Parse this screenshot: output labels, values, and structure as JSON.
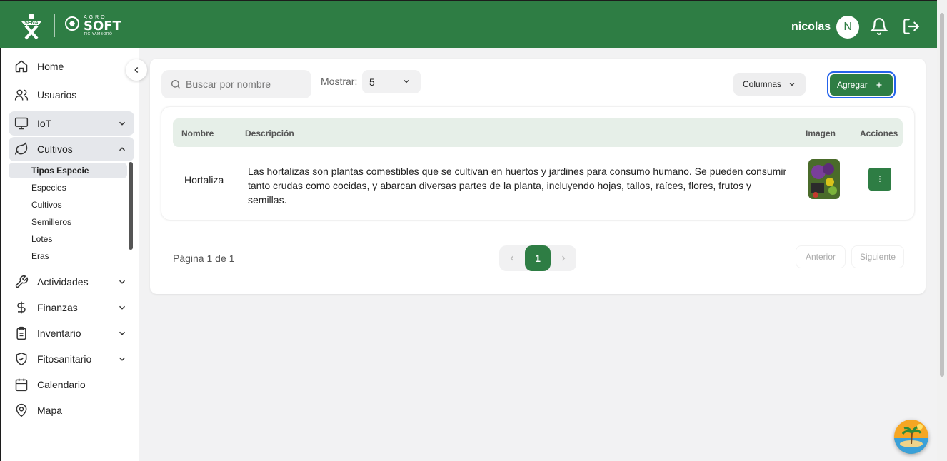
{
  "header": {
    "brand_sena": "SENA",
    "brand_agro": "AGRO",
    "brand_soft": "SOFT",
    "brand_tic": "TIC-YAMBORÓ",
    "user_name": "nicolas",
    "avatar_initial": "N",
    "bar_color": "#2e7d44"
  },
  "sidebar": {
    "items": [
      {
        "label": "Home",
        "icon": "home-icon"
      },
      {
        "label": "Usuarios",
        "icon": "users-icon"
      },
      {
        "label": "IoT",
        "icon": "monitor-icon"
      },
      {
        "label": "Cultivos",
        "icon": "leaf-icon"
      },
      {
        "label": "Actividades",
        "icon": "wrench-icon"
      },
      {
        "label": "Finanzas",
        "icon": "dollar-icon"
      },
      {
        "label": "Inventario",
        "icon": "clipboard-icon"
      },
      {
        "label": "Fitosanitario",
        "icon": "shield-icon"
      },
      {
        "label": "Calendario",
        "icon": "calendar-icon"
      },
      {
        "label": "Mapa",
        "icon": "map-pin-icon"
      }
    ],
    "sub_items": [
      "Tipos Especie",
      "Especies",
      "Cultivos",
      "Semilleros",
      "Lotes",
      "Eras"
    ]
  },
  "toolbar": {
    "search_placeholder": "Buscar por nombre",
    "show_label": "Mostrar:",
    "show_value": "5",
    "columns_label": "Columnas",
    "add_label": "Agregar"
  },
  "table": {
    "headers": [
      "Nombre",
      "Descripción",
      "Imagen",
      "Acciones"
    ],
    "rows": [
      {
        "name": "Hortaliza",
        "description": "Las hortalizas son plantas comestibles que se cultivan en huertos y jardines para consumo humano. Se pueden consumir tanto crudas como cocidas, y abarcan diversas partes de la planta, incluyendo hojas, tallos, raíces, flores, frutos y semillas.",
        "action": "⋮"
      }
    ]
  },
  "pagination": {
    "page_text": "Página 1 de 1",
    "current_page": "1",
    "prev_label": "Anterior",
    "next_label": "Siguiente"
  }
}
